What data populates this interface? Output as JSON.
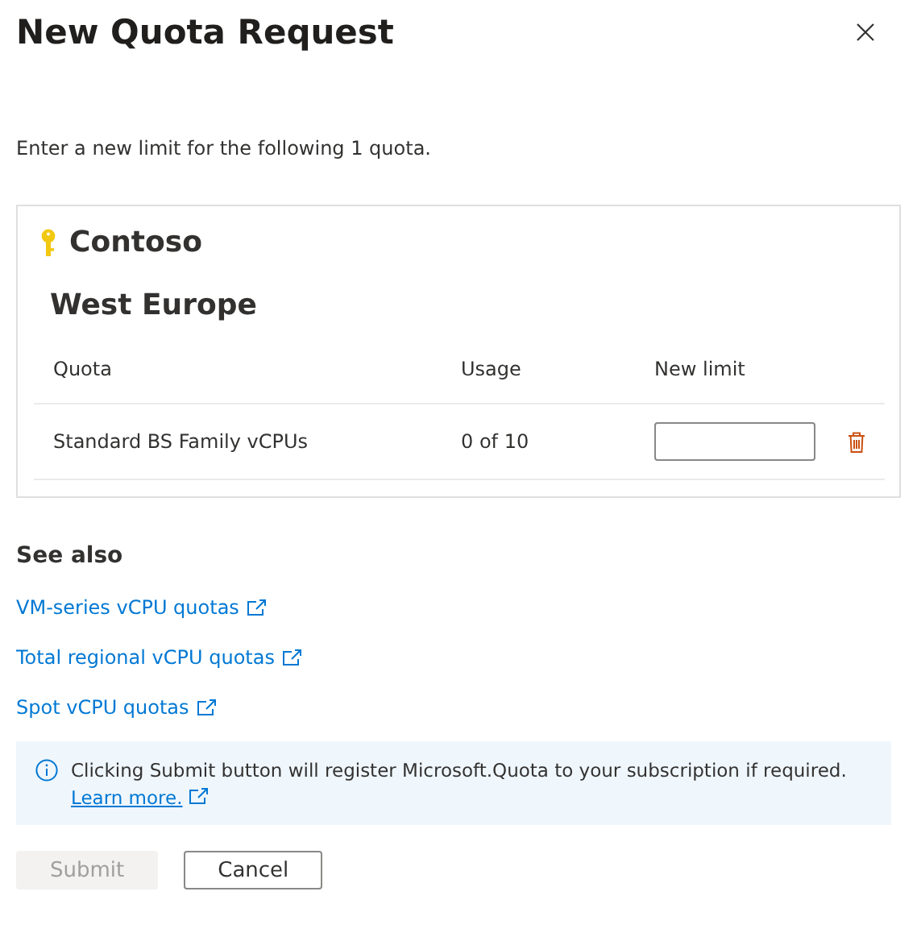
{
  "title": "New Quota Request",
  "intro": "Enter a new limit for the following 1 quota.",
  "card": {
    "name": "Contoso",
    "region": "West Europe",
    "columns": [
      "Quota",
      "Usage",
      "New limit"
    ],
    "rows": [
      {
        "quota": "Standard BS Family vCPUs",
        "usage": "0 of 10",
        "new_limit": ""
      }
    ]
  },
  "see_also": {
    "heading": "See also",
    "links": [
      "VM-series vCPU quotas",
      "Total regional vCPU quotas",
      "Spot vCPU quotas"
    ]
  },
  "info": {
    "text": "Clicking Submit button will register Microsoft.Quota to your subscription if required.",
    "link": "Learn more."
  },
  "buttons": [
    {
      "label": "Submit",
      "disabled": true
    },
    {
      "label": "Cancel",
      "disabled": false
    }
  ]
}
